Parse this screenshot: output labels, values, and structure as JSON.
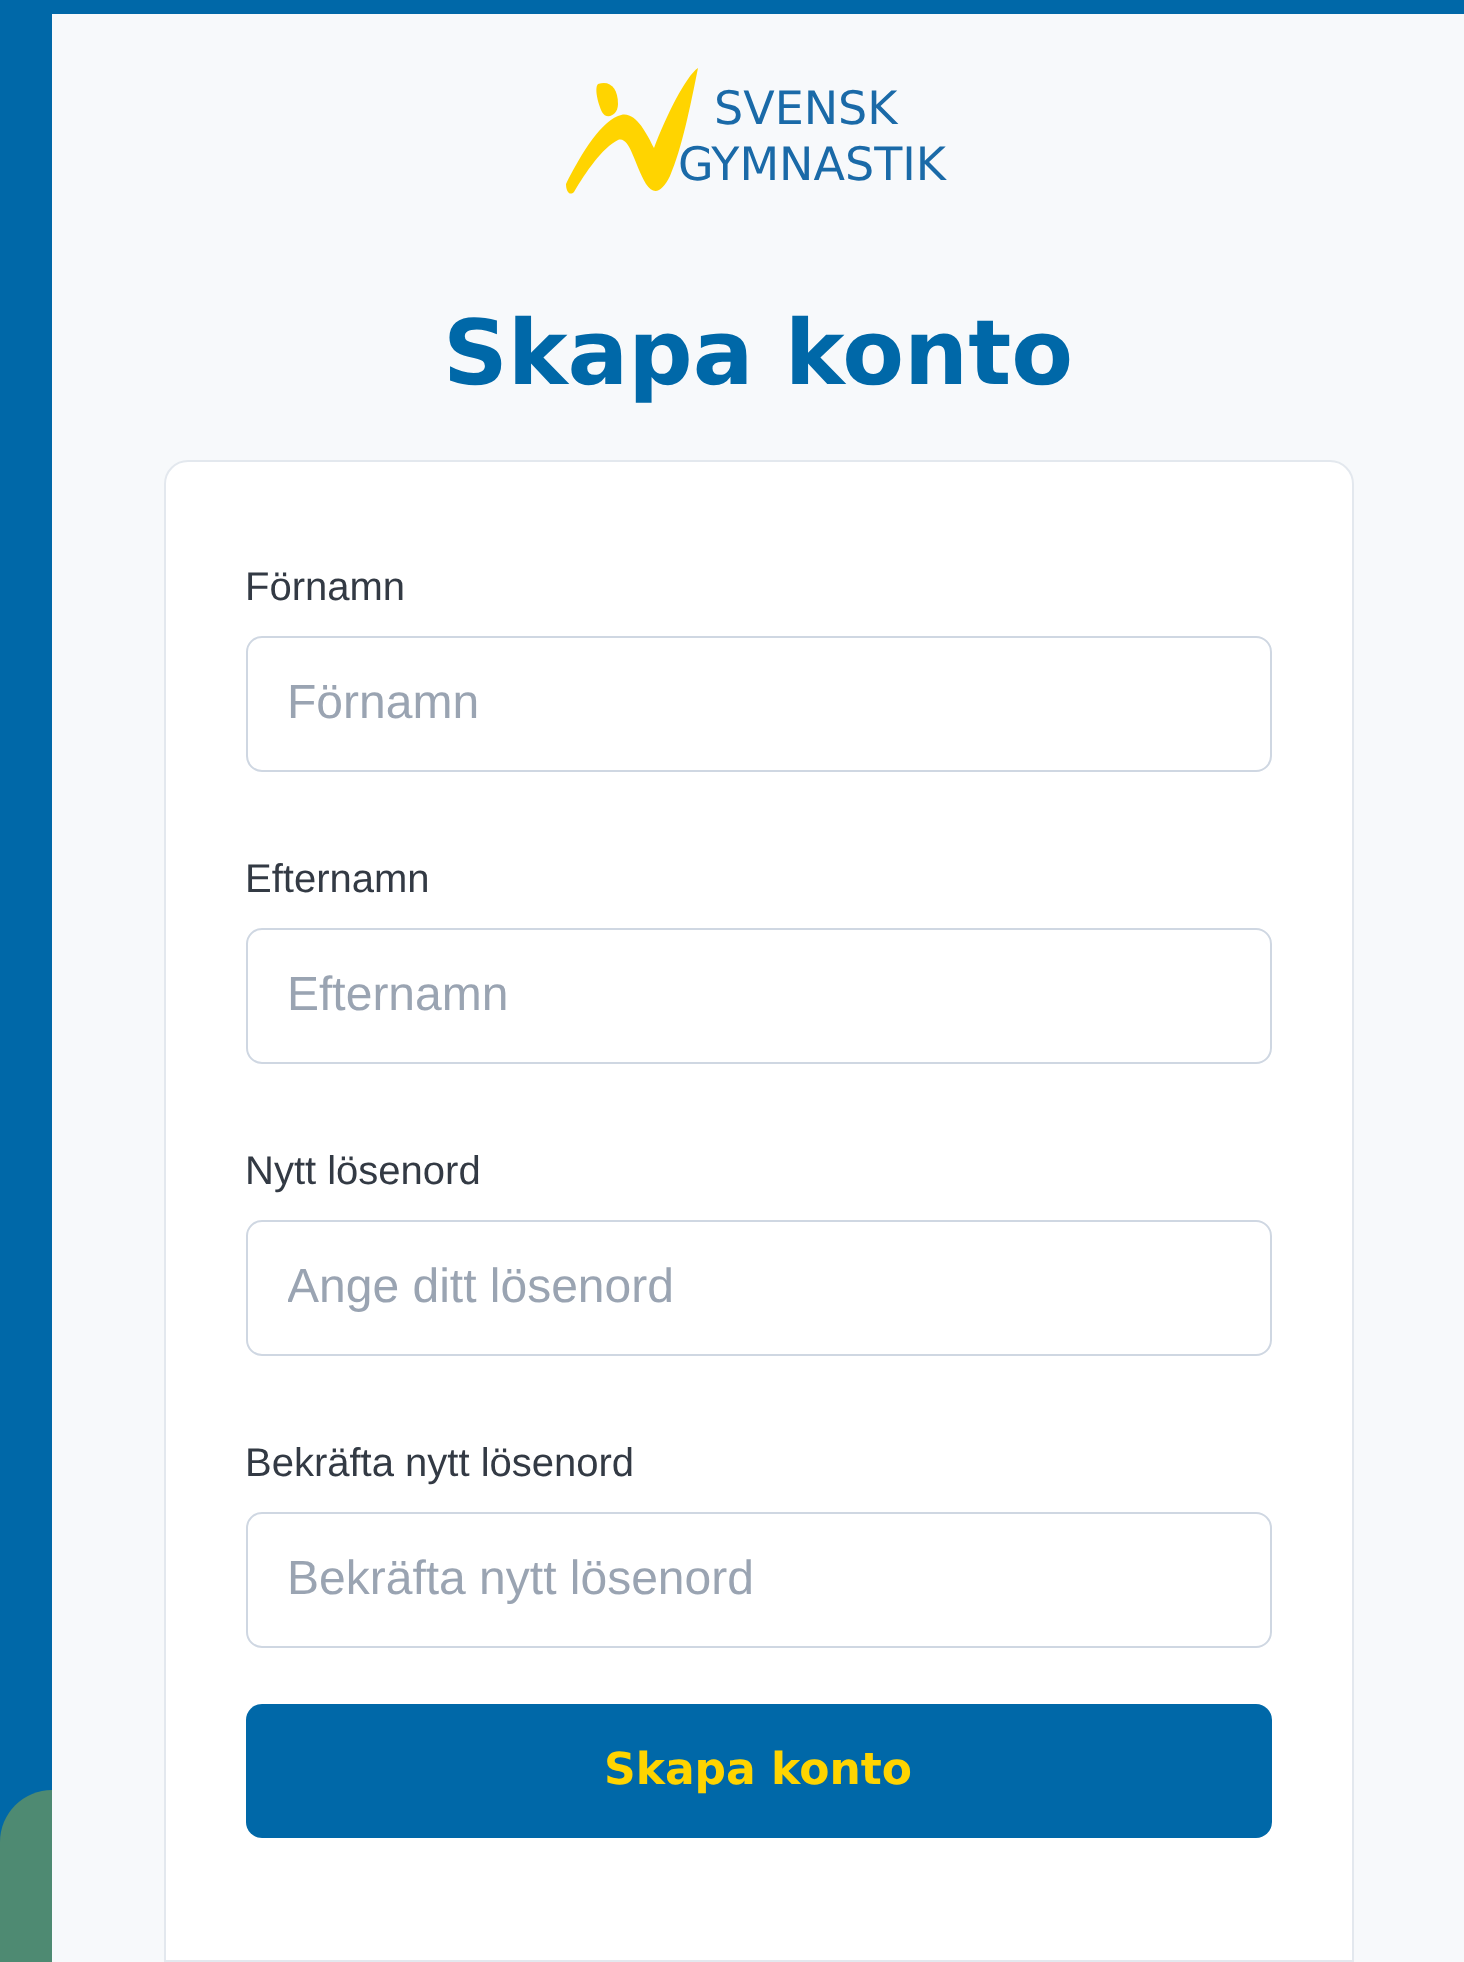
{
  "logo": {
    "line_1": "SVENSK",
    "line_2": "GYMNASTIK"
  },
  "title": "Skapa konto",
  "fields": [
    {
      "label": "Förnamn",
      "placeholder": "Förnamn"
    },
    {
      "label": "Efternamn",
      "placeholder": "Efternamn"
    },
    {
      "label": "Nytt lösenord",
      "placeholder": "Ange ditt lösenord"
    },
    {
      "label": "Bekräfta nytt lösenord",
      "placeholder": "Bekräfta nytt lösenord"
    }
  ],
  "submit_button": "Skapa konto"
}
